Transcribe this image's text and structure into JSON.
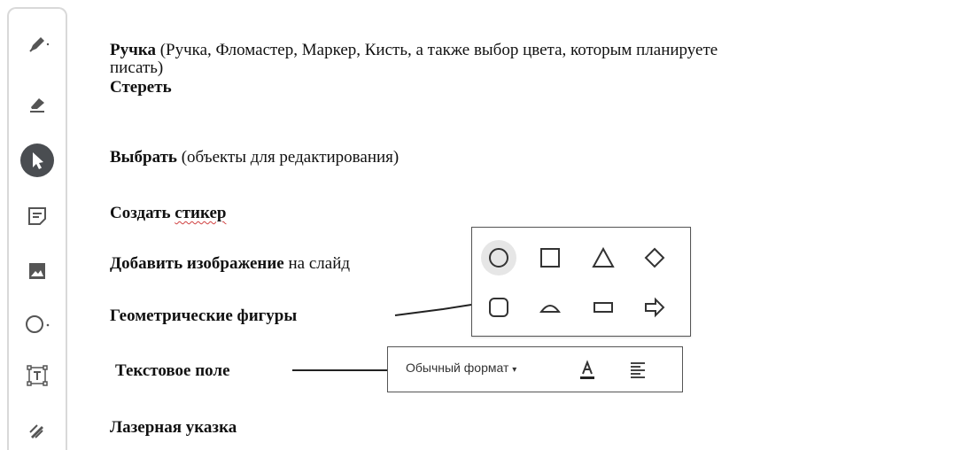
{
  "toolbar": {
    "tools": [
      {
        "name": "pen-tool",
        "icon": "pen-icon"
      },
      {
        "name": "eraser-tool",
        "icon": "eraser-icon"
      },
      {
        "name": "select-tool",
        "icon": "cursor-arrow-icon",
        "active": true
      },
      {
        "name": "sticky-note-tool",
        "icon": "sticky-note-icon"
      },
      {
        "name": "image-tool",
        "icon": "image-icon"
      },
      {
        "name": "shapes-tool",
        "icon": "circle-icon"
      },
      {
        "name": "text-box-tool",
        "icon": "text-box-icon"
      },
      {
        "name": "laser-tool",
        "icon": "laser-pointer-icon"
      }
    ]
  },
  "content": {
    "pen": {
      "bold": "Ручка",
      "rest": " (Ручка, Фломастер, Маркер, Кисть, а также выбор цвета, которым планируете",
      "cont": "писать)"
    },
    "erase": {
      "bold": "Стереть"
    },
    "select": {
      "bold": "Выбрать",
      "rest": " (объекты для редактирования)"
    },
    "sticker": {
      "bold1": "Создать ",
      "bold2": "стикер"
    },
    "image": {
      "bold": "Добавить изображение",
      "rest": " на слайд"
    },
    "shapes": {
      "bold": "Геометрические фигуры"
    },
    "textbox": {
      "bold": "Текстовое поле"
    },
    "laser": {
      "bold": "Лазерная указка"
    }
  },
  "shapes_palette": {
    "shapes": [
      "circle",
      "square",
      "triangle",
      "diamond",
      "rounded-rectangle",
      "half-circle",
      "rectangle",
      "arrow-right"
    ],
    "selected": "circle"
  },
  "format_bar": {
    "style_label": "Обычный формат",
    "style_arrow": "▾"
  },
  "colors": {
    "active_tool": "#4a4d51",
    "icon": "#555555",
    "spell_underline": "#d04040"
  }
}
